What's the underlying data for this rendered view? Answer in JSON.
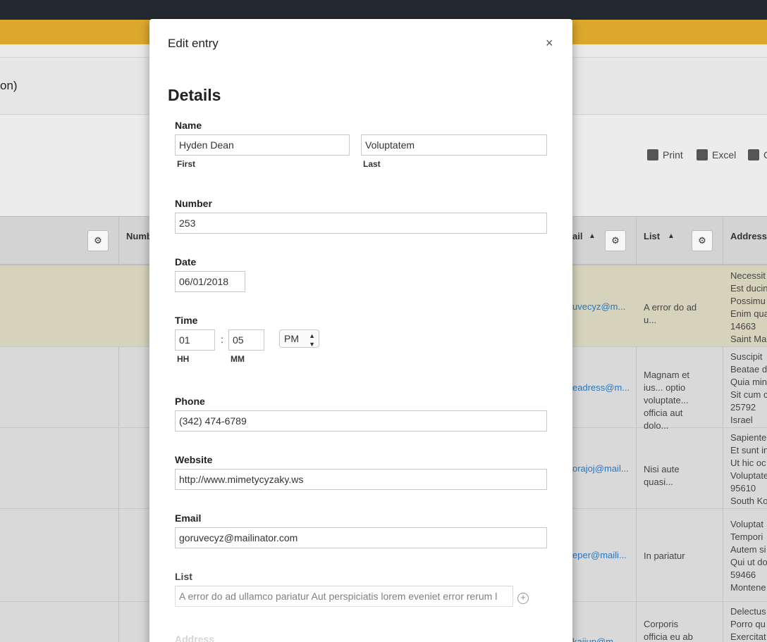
{
  "background": {
    "page_title_fragment": "on)",
    "toolbar": {
      "print": "Print",
      "excel": "Excel",
      "csv": "C"
    },
    "headers": {
      "number": "Numb",
      "email": "ail",
      "list": "List",
      "address": "Address"
    },
    "sort_glyph": "▲",
    "gear_glyph": "⚙",
    "rows": [
      {
        "email": "uvecyz@m...",
        "list": "A error do ad u...",
        "address": [
          "Necessit",
          "Est ducin",
          "Possimu",
          "Enim qua",
          "14663",
          "Saint Ma"
        ]
      },
      {
        "email": "eadress@m...",
        "list": "Magnam et ius... optio voluptate... officia aut dolo...",
        "address": [
          "Suscipit",
          "Beatae d",
          "Quia min",
          "Sit cum c",
          "25792",
          "Israel"
        ]
      },
      {
        "email": "orajoj@mail...",
        "list": "Nisi aute quasi...",
        "address": [
          "Sapiente",
          "Et sunt in",
          "Ut hic oc",
          "Voluptate",
          "95610",
          "South Ko"
        ]
      },
      {
        "email": "eper@maili...",
        "list": "In pariatur",
        "address": [
          "Voluptat",
          "Tempori",
          "Autem si",
          "Qui ut do",
          "59466",
          "Montene"
        ]
      },
      {
        "email": "kaijup@m...",
        "list": "Corporis officia eu ab consequ...",
        "address": [
          "Delectus",
          "Porro qu",
          "Exercitat"
        ]
      }
    ]
  },
  "modal": {
    "title": "Edit entry",
    "close_glyph": "×",
    "section": "Details",
    "name": {
      "label": "Name",
      "first_value": "Hyden Dean",
      "first_label": "First",
      "last_value": "Voluptatem",
      "last_label": "Last"
    },
    "number": {
      "label": "Number",
      "value": "253"
    },
    "date": {
      "label": "Date",
      "value": "06/01/2018"
    },
    "time": {
      "label": "Time",
      "hh": "01",
      "mm": "05",
      "hh_label": "HH",
      "mm_label": "MM",
      "colon": ":",
      "ampm": "PM"
    },
    "phone": {
      "label": "Phone",
      "value": "(342) 474-6789"
    },
    "website": {
      "label": "Website",
      "value": "http://www.mimetycyzaky.ws"
    },
    "email": {
      "label": "Email",
      "value": "goruvecyz@mailinator.com"
    },
    "list": {
      "label": "List",
      "value": "A error do ad ullamco pariatur Aut perspiciatis lorem eveniet error rerum l",
      "add_glyph": "+"
    },
    "address": {
      "label": "Address"
    }
  }
}
